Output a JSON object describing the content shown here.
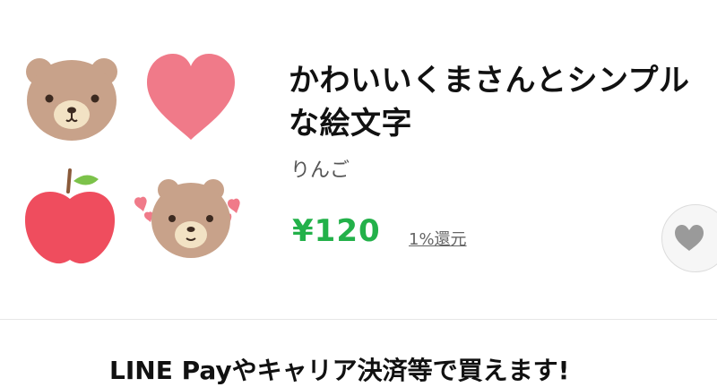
{
  "product": {
    "title": "かわいいくまさんとシンプルな絵文字",
    "author": "りんご",
    "price": "¥120",
    "points": "1%還元"
  },
  "preview": {
    "icons": [
      "bear-face-icon",
      "heart-icon",
      "apple-icon",
      "bear-with-hearts-icon"
    ]
  },
  "colors": {
    "price": "#23b14a",
    "bear": "#c8a28a",
    "heart": "#f07a89",
    "apple": "#ef4d5e"
  },
  "notice": "LINE Payやキャリア決済等で買えます!"
}
